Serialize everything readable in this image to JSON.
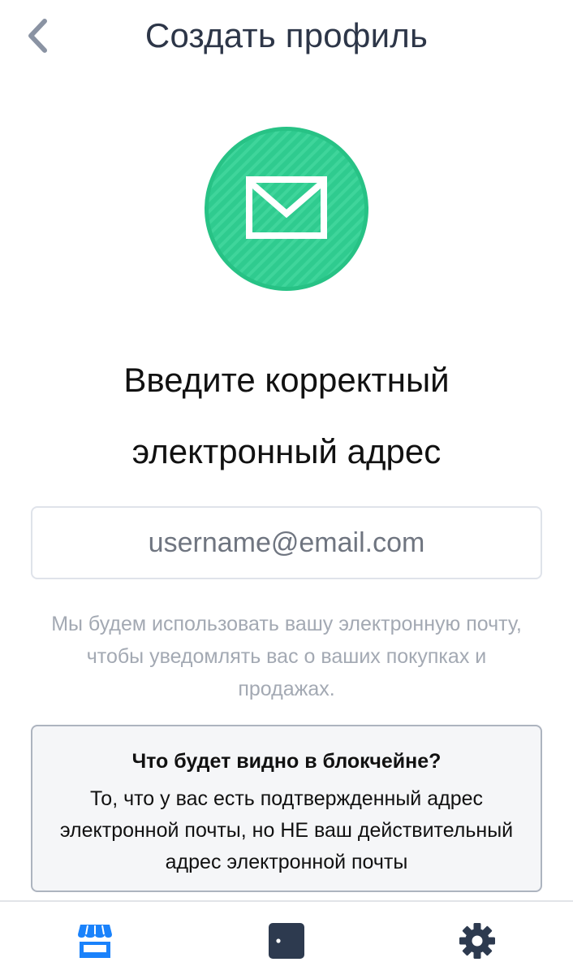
{
  "header": {
    "title": "Создать профиль",
    "back_icon": "chevron-left-icon"
  },
  "badge": {
    "icon": "envelope-icon",
    "color": "#2fcb8f"
  },
  "heading": {
    "line1": "Введите корректный",
    "line2": "электронный адрес"
  },
  "email_input": {
    "value": "",
    "placeholder": "username@email.com"
  },
  "note": {
    "line1": "Мы будем использовать вашу электронную почту,",
    "line2": "чтобы уведомлять вас о ваших покупках и",
    "line3": "продажах."
  },
  "info_box": {
    "title": "Что будет видно в блокчейне?",
    "line1": "То, что у вас есть подтвержденный адрес",
    "line2": "электронной почты, но НЕ ваш действительный",
    "line3": "адрес электронной почты"
  },
  "tabbar": {
    "active_color": "#1a82fb",
    "inactive_color": "#2d3a4f",
    "tabs": [
      {
        "id": "shop",
        "icon": "storefront-icon",
        "active": true
      },
      {
        "id": "wallet",
        "icon": "wallet-icon",
        "active": false
      },
      {
        "id": "settings",
        "icon": "gear-icon",
        "active": false
      }
    ]
  }
}
